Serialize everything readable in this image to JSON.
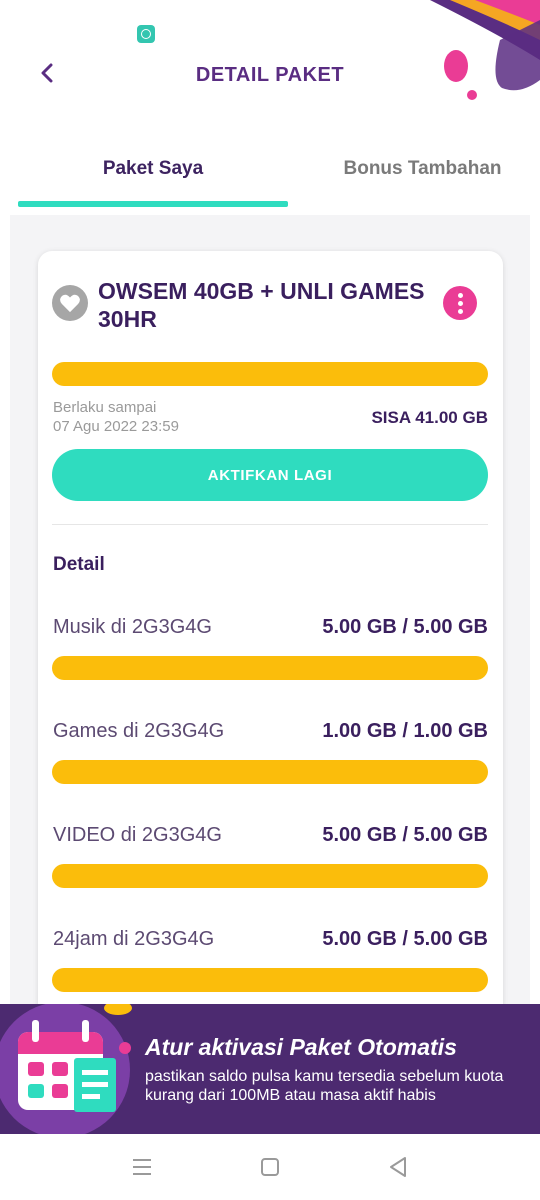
{
  "status_bar": {
    "app_icon": "chat-bubble-icon"
  },
  "header": {
    "title": "DETAIL PAKET",
    "back_icon": "chevron-left-icon"
  },
  "tabs": [
    {
      "label": "Paket Saya",
      "active": true
    },
    {
      "label": "Bonus Tambahan",
      "active": false
    }
  ],
  "package": {
    "name": "OWSEM 40GB + UNLI GAMES 30HR",
    "icon": "heart-icon",
    "menu_icon": "more-vertical-icon",
    "valid_label": "Berlaku sampai",
    "valid_date": "07 Agu 2022 23:59",
    "remaining": "SISA  41.00 GB",
    "remaining_fraction": 1.0,
    "activate_label": "AKTIFKAN LAGI"
  },
  "detail": {
    "heading": "Detail",
    "items": [
      {
        "label": "Musik di 2G3G4G",
        "value": "5.00 GB / 5.00 GB",
        "fraction": 1.0
      },
      {
        "label": "Games di 2G3G4G",
        "value": "1.00 GB / 1.00 GB",
        "fraction": 1.0
      },
      {
        "label": "VIDEO di 2G3G4G",
        "value": "5.00 GB / 5.00 GB",
        "fraction": 1.0
      },
      {
        "label": "24jam di 2G3G4G",
        "value": "5.00 GB / 5.00 GB",
        "fraction": 1.0
      }
    ]
  },
  "banner": {
    "title": "Atur aktivasi Paket Otomatis",
    "text": "pastikan saldo pulsa kamu tersedia sebelum kuota kurang dari 100MB atau masa aktif habis",
    "icon": "calendar-icon"
  },
  "nav": {
    "menu_icon": "menu-icon",
    "home_icon": "square-icon",
    "back_icon": "triangle-back-icon"
  },
  "colors": {
    "accent": "#2fdcbf",
    "bar": "#fbbd0b",
    "title": "#5a2d82",
    "banner": "#4c2a70",
    "pink": "#ea3c95"
  }
}
